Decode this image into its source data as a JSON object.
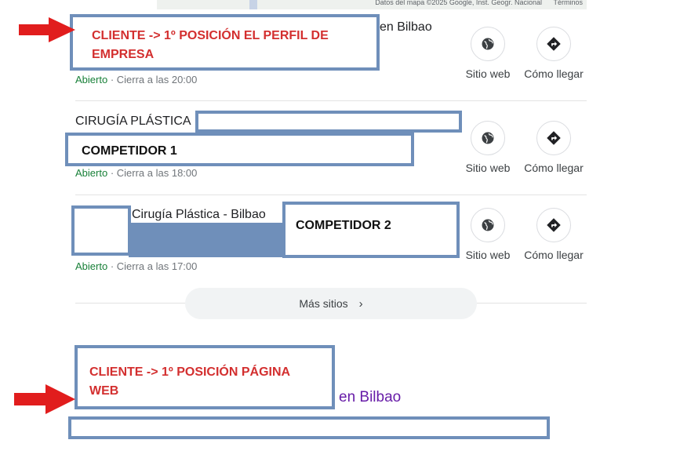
{
  "map": {
    "attribution": "Datos del mapa ©2025 Google, Inst. Geogr. Nacional",
    "terms": "Términos"
  },
  "listings": [
    {
      "name_visible": "en Bilbao",
      "status_open": "Abierto",
      "status_close": " · Cierra a las 20:00",
      "website_label": "Sitio web",
      "directions_label": "Cómo llegar"
    },
    {
      "name_visible": "CIRUGÍA PLÁSTICA",
      "status_open": "Abierto",
      "status_close": " · Cierra a las 18:00",
      "website_label": "Sitio web",
      "directions_label": "Cómo llegar"
    },
    {
      "name_visible": "Cirugía Plástica - Bilbao",
      "status_open": "Abierto",
      "status_close": " · Cierra a las 17:00",
      "website_label": "Sitio web",
      "directions_label": "Cómo llegar"
    }
  ],
  "more_places": "Más sitios",
  "annotations": {
    "client_profile_line1": "CLIENTE -> 1º POSICIÓN EL PERFIL DE",
    "client_profile_line2": "EMPRESA",
    "competitor1": "COMPETIDOR 1",
    "competitor2": "COMPETIDOR 2",
    "client_web_line1": "CLIENTE -> 1º POSICIÓN PÁGINA",
    "client_web_line2": "WEB"
  },
  "web_result": {
    "title_visible": "en Bilbao"
  },
  "colors": {
    "annotation_border": "#6f8fba",
    "annotation_red": "#d32f2f",
    "open_green": "#188038",
    "visited_link": "#681da8",
    "arrow_red": "#e11d1d"
  },
  "icons": {
    "website": "globe-icon",
    "directions": "directions-icon",
    "arrow": "red-arrow-icon",
    "more": "chevron-right-icon"
  }
}
